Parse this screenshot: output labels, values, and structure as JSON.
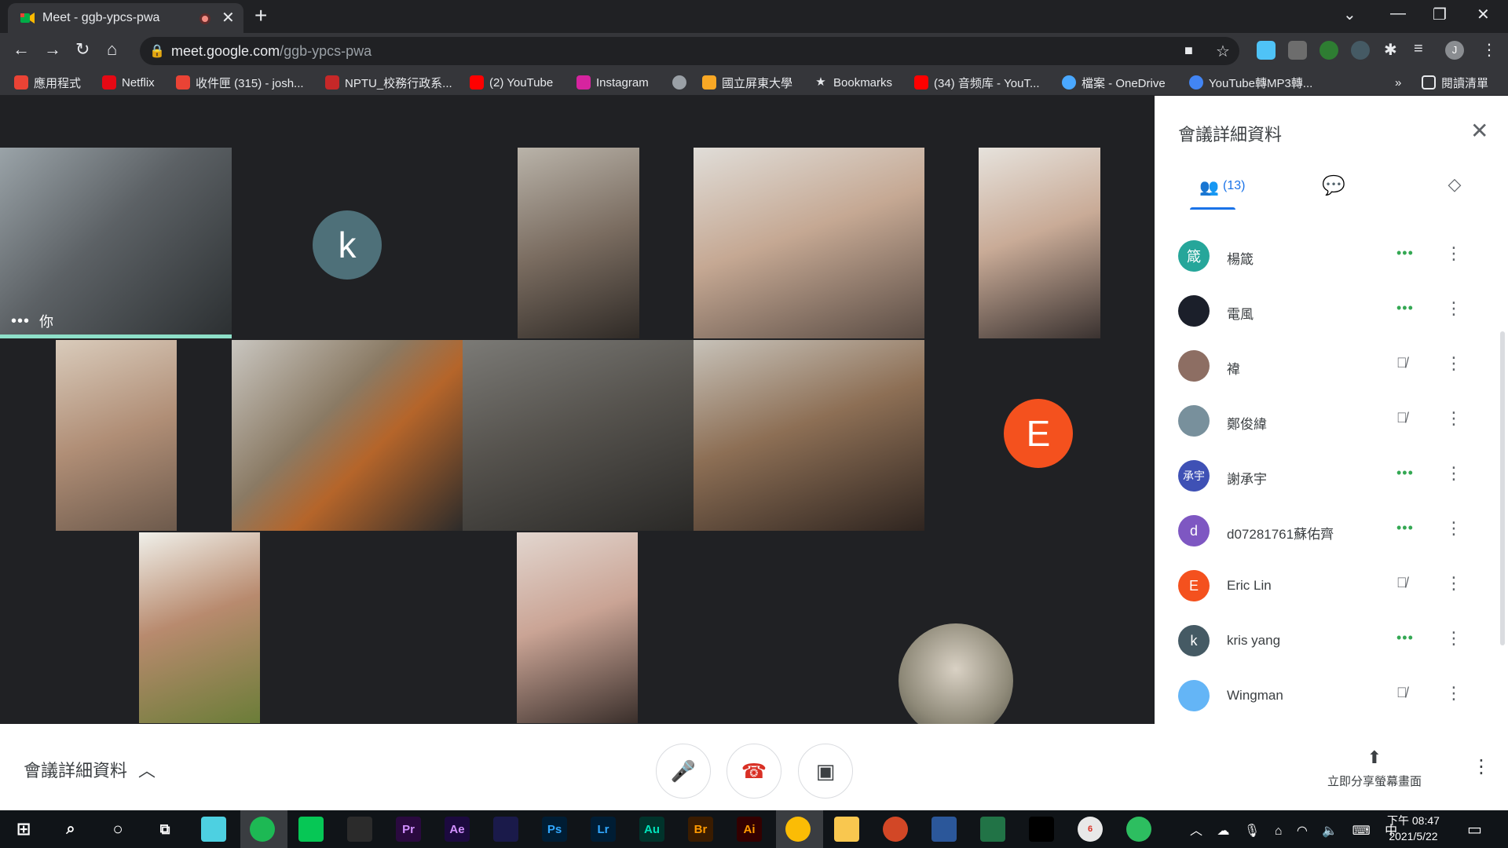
{
  "browser": {
    "tab_title": "Meet - ggb-ypcs-pwa",
    "url_host": "meet.google.com",
    "url_path": "/ggb-ypcs-pwa",
    "profile_initial": "J"
  },
  "bookmarks": [
    {
      "label": "應用程式",
      "icon": "apps-grid-icon",
      "color": "#ea4335"
    },
    {
      "label": "Netflix",
      "icon": "netflix-icon",
      "color": "#e50914"
    },
    {
      "label": "收件匣 (315) - josh...",
      "icon": "gmail-icon",
      "color": "#ea4335"
    },
    {
      "label": "NPTU_校務行政系...",
      "icon": "nptu-icon",
      "color": "#c62828"
    },
    {
      "label": "(2) YouTube",
      "icon": "youtube-icon",
      "color": "#ff0000"
    },
    {
      "label": "Instagram",
      "icon": "instagram-icon",
      "color": "#d6249f"
    },
    {
      "label": "",
      "icon": "globe-icon",
      "color": "#9aa0a6"
    },
    {
      "label": "國立屏東大學",
      "icon": "rainbow-icon",
      "color": "#f9a825"
    },
    {
      "label": "Bookmarks",
      "icon": "star-icon",
      "color": "#e8eaed"
    },
    {
      "label": "(34) 音频库 - YouT...",
      "icon": "youtube-icon",
      "color": "#ff0000"
    },
    {
      "label": "檔案 - OneDrive",
      "icon": "onedrive-icon",
      "color": "#4aa8ff"
    },
    {
      "label": "YouTube轉MP3轉...",
      "icon": "converter-icon",
      "color": "#4285f4"
    }
  ],
  "bookmarks_overflow": "»",
  "reading_list": "閱讀清單",
  "meet": {
    "self_label": "你",
    "self_dots": "•••",
    "tile_k_initial": "k",
    "tile_e_initial": "E"
  },
  "panel": {
    "title": "會議詳細資料",
    "people_count": "(13)",
    "participants": [
      {
        "name": "楊箴",
        "avatar_text": "箴",
        "avatar_color": "#26a69a",
        "status": "speaking"
      },
      {
        "name": "電風",
        "avatar_text": "",
        "avatar_color": "#1b1f2a",
        "status": "speaking"
      },
      {
        "name": "褘",
        "avatar_text": "",
        "avatar_color": "#8d6e63",
        "status": "muted"
      },
      {
        "name": "鄭俊緯",
        "avatar_text": "",
        "avatar_color": "#78909c",
        "status": "muted"
      },
      {
        "name": "謝承宇",
        "avatar_text": "承宇",
        "avatar_color": "#3f51b5",
        "status": "speaking"
      },
      {
        "name": "d07281761蘇佑齊",
        "avatar_text": "d",
        "avatar_color": "#7e57c2",
        "status": "speaking"
      },
      {
        "name": "Eric Lin",
        "avatar_text": "E",
        "avatar_color": "#f4511e",
        "status": "muted"
      },
      {
        "name": "kris yang",
        "avatar_text": "k",
        "avatar_color": "#455a64",
        "status": "speaking"
      },
      {
        "name": "Wingman",
        "avatar_text": "",
        "avatar_color": "#64b5f6",
        "status": "muted"
      }
    ]
  },
  "controls": {
    "details_label": "會議詳細資料",
    "present_label": "立即分享螢幕畫面"
  },
  "taskbar": {
    "apps": [
      "Pr",
      "Ae",
      "Ps",
      "Lr",
      "Au",
      "Br",
      "Ai"
    ],
    "ime": "中",
    "time": "下午 08:47",
    "date": "2021/5/22",
    "badge": "6"
  }
}
